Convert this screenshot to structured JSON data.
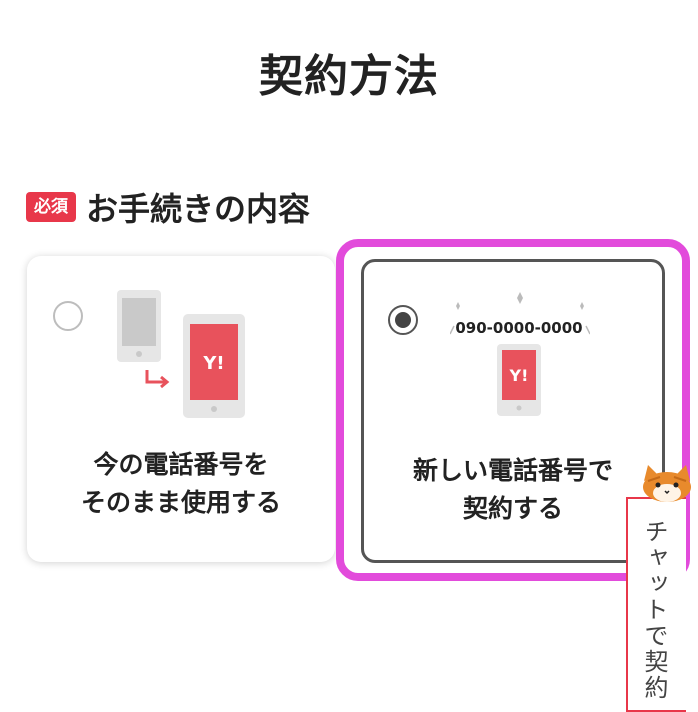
{
  "page": {
    "title": "契約方法"
  },
  "section": {
    "required_label": "必須",
    "title": "お手続きの内容"
  },
  "options": [
    {
      "label_line1": "今の電話番号を",
      "label_line2": "そのまま使用する",
      "selected": false,
      "phone_logo": "Y!"
    },
    {
      "label_line1": "新しい電話番号で",
      "label_line2": "契約する",
      "selected": true,
      "number": "090-0000-0000",
      "phone_logo": "Y!"
    }
  ],
  "chat": {
    "label": "チャットで契約"
  },
  "colors": {
    "accent_red": "#e8374a",
    "highlight_magenta": "#e24bdb",
    "phone_red": "#e8525c"
  }
}
